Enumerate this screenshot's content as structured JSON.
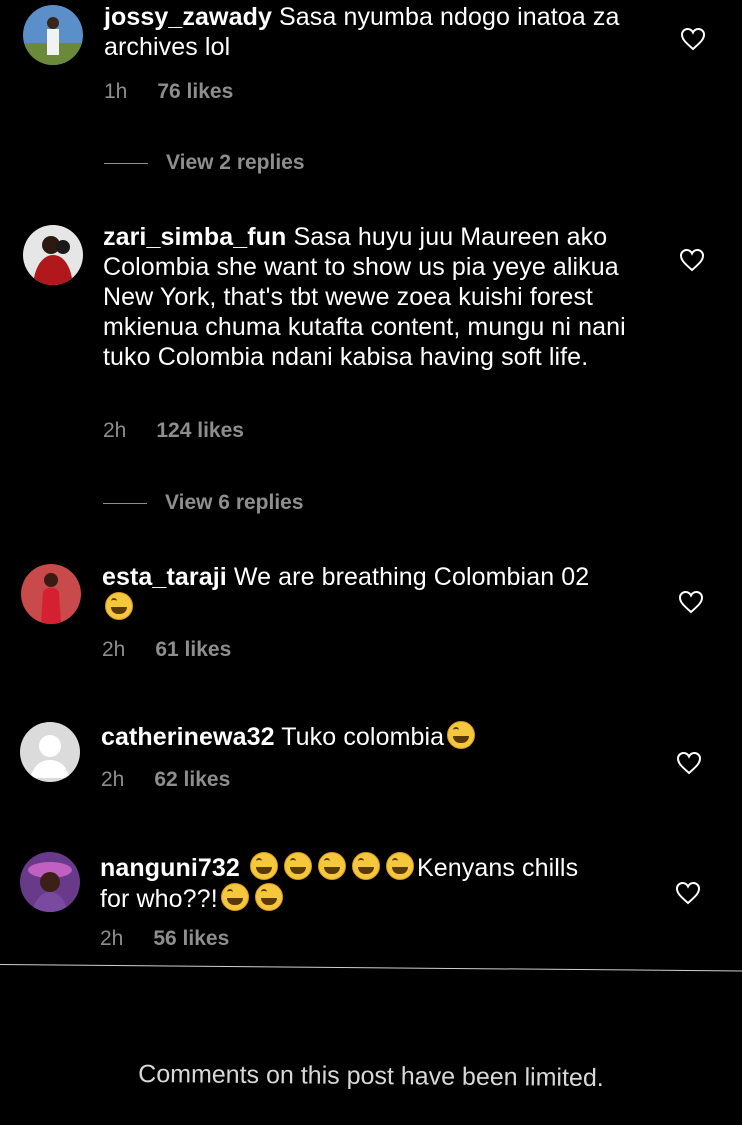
{
  "comments": [
    {
      "username": "jossy_zawady",
      "text": "Sasa nyumba ndogo inatoa za archives lol",
      "time": "1h",
      "likes": "76 likes",
      "replies": "View 2 replies"
    },
    {
      "username": "zari_simba_fun",
      "text": "Sasa huyu juu Maureen ako Colombia she want to show us pia yeye alikua New York, that's tbt wewe zoea kuishi forest mkienua chuma kutafta content, mungu ni nani tuko Colombia ndani kabisa having soft life.",
      "time": "2h",
      "likes": "124 likes",
      "replies": "View 6 replies"
    },
    {
      "username": "esta_taraji",
      "text": "We are breathing Colombian 02",
      "time": "2h",
      "likes": "61 likes"
    },
    {
      "username": "catherinewa32",
      "text": "Tuko colombia",
      "time": "2h",
      "likes": "62 likes"
    },
    {
      "username": "nanguni732",
      "text_a": "Kenyans chills",
      "text_b": "for who??!",
      "time": "2h",
      "likes": "56 likes"
    }
  ],
  "footer": "Comments on this post have been limited.",
  "icons": {
    "like": "heart-outline-icon",
    "emoji": "face-with-tears-of-joy-icon"
  },
  "colors": {
    "background": "#000000",
    "text": "#ffffff",
    "muted": "#8e8e8e"
  }
}
